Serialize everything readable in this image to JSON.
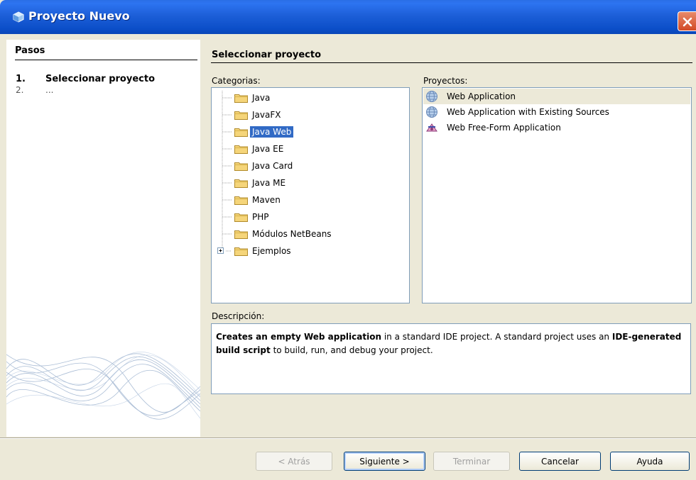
{
  "window": {
    "title": "Proyecto Nuevo"
  },
  "steps": {
    "title": "Pasos",
    "items": [
      {
        "num": "1.",
        "label": "Seleccionar proyecto"
      },
      {
        "num": "2.",
        "label": "..."
      }
    ]
  },
  "main": {
    "title": "Seleccionar proyecto",
    "categories_label": "Categorias:",
    "projects_label": "Proyectos:",
    "description_label": "Descripción:"
  },
  "categories": [
    {
      "label": "Java"
    },
    {
      "label": "JavaFX"
    },
    {
      "label": "Java Web",
      "selected": true
    },
    {
      "label": "Java EE"
    },
    {
      "label": "Java Card"
    },
    {
      "label": "Java ME"
    },
    {
      "label": "Maven"
    },
    {
      "label": "PHP"
    },
    {
      "label": "Módulos NetBeans"
    },
    {
      "label": "Ejemplos",
      "expandable": true
    }
  ],
  "projects": [
    {
      "label": "Web Application",
      "icon": "globe-icon",
      "selected": true
    },
    {
      "label": "Web Application with Existing Sources",
      "icon": "globe-icon"
    },
    {
      "label": "Web Free-Form Application",
      "icon": "freeform-icon"
    }
  ],
  "description": {
    "b1": "Creates an empty Web application",
    "t1": " in a standard IDE project. A standard project uses an ",
    "b2": "IDE-generated build script",
    "t2": " to build, run, and debug your project."
  },
  "buttons": {
    "back": "< Atrás",
    "next": "Siguiente >",
    "finish": "Terminar",
    "cancel": "Cancelar",
    "help": "Ayuda"
  },
  "colors": {
    "titlebar": "#0b4ec8",
    "selection": "#316ac5",
    "dialog_bg": "#ece9d8"
  }
}
